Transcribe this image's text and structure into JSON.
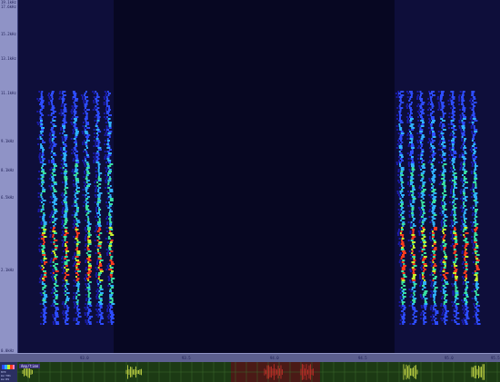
{
  "app": {
    "freq_axis": {
      "labels": [
        "19.1kHz",
        "17.6kHz",
        "15.2kHz",
        "13.1kHz",
        "11.1kHz",
        "9.1kHz",
        "8.1kHz",
        "6.5kHz",
        "2.1kHz",
        "0.0kHz"
      ]
    },
    "time_axis": {
      "labels": [
        "93.0",
        "93.5",
        "94.0",
        "94.5",
        "95.0",
        "95.5"
      ]
    },
    "overview": {
      "title": "Amp/time",
      "side_lines": [
        "870",
        "ms:781",
        "ms:89"
      ],
      "colors": {
        "background": "#1c3a14",
        "grid": "#3b6a2a",
        "waveform": "#d8e84a",
        "selection": "#4a1a16",
        "selection_wave": "#c8322a"
      }
    },
    "spectrogram": {
      "background": "#070722",
      "colors": [
        "#1a1aa8",
        "#2d4cff",
        "#2fb0ff",
        "#39e0a0",
        "#c6f02c",
        "#ff3b1e"
      ],
      "left_call": {
        "pulses": 7
      },
      "right_call": {
        "pulses": 8
      }
    }
  }
}
